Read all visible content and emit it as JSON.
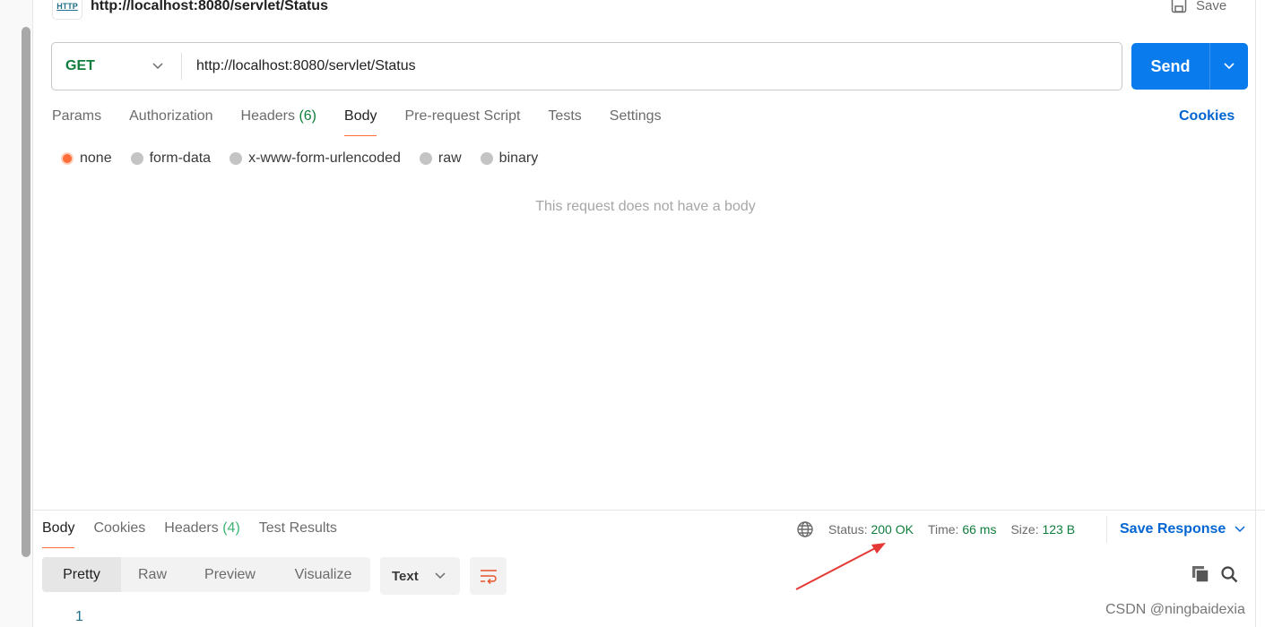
{
  "header": {
    "title": "http://localhost:8080/servlet/Status",
    "icon_text": "HTTP",
    "save_label": "Save"
  },
  "request": {
    "method": "GET",
    "url": "http://localhost:8080/servlet/Status",
    "send_label": "Send"
  },
  "tabs": [
    {
      "label": "Params"
    },
    {
      "label": "Authorization"
    },
    {
      "label": "Headers",
      "count": "(6)"
    },
    {
      "label": "Body"
    },
    {
      "label": "Pre-request Script"
    },
    {
      "label": "Tests"
    },
    {
      "label": "Settings"
    }
  ],
  "active_tab": "Body",
  "cookies_label": "Cookies",
  "body_types": [
    {
      "label": "none",
      "selected": true
    },
    {
      "label": "form-data"
    },
    {
      "label": "x-www-form-urlencoded"
    },
    {
      "label": "raw"
    },
    {
      "label": "binary"
    }
  ],
  "no_body_message": "This request does not have a body",
  "response": {
    "tabs": [
      {
        "label": "Body"
      },
      {
        "label": "Cookies"
      },
      {
        "label": "Headers",
        "count": "(4)"
      },
      {
        "label": "Test Results"
      }
    ],
    "status_label": "Status:",
    "status": "200 OK",
    "time_label": "Time:",
    "time": "66 ms",
    "size_label": "Size:",
    "size": "123 B",
    "save_response": "Save Response",
    "views": [
      "Pretty",
      "Raw",
      "Preview",
      "Visualize"
    ],
    "format": "Text",
    "line_number": "1"
  },
  "watermark": "CSDN @ningbaidexia",
  "colors": {
    "accent": "#ff6c37",
    "primary": "#097bed",
    "success": "#0f7d3c",
    "link": "#0265d2",
    "annotation": "#e53935"
  }
}
